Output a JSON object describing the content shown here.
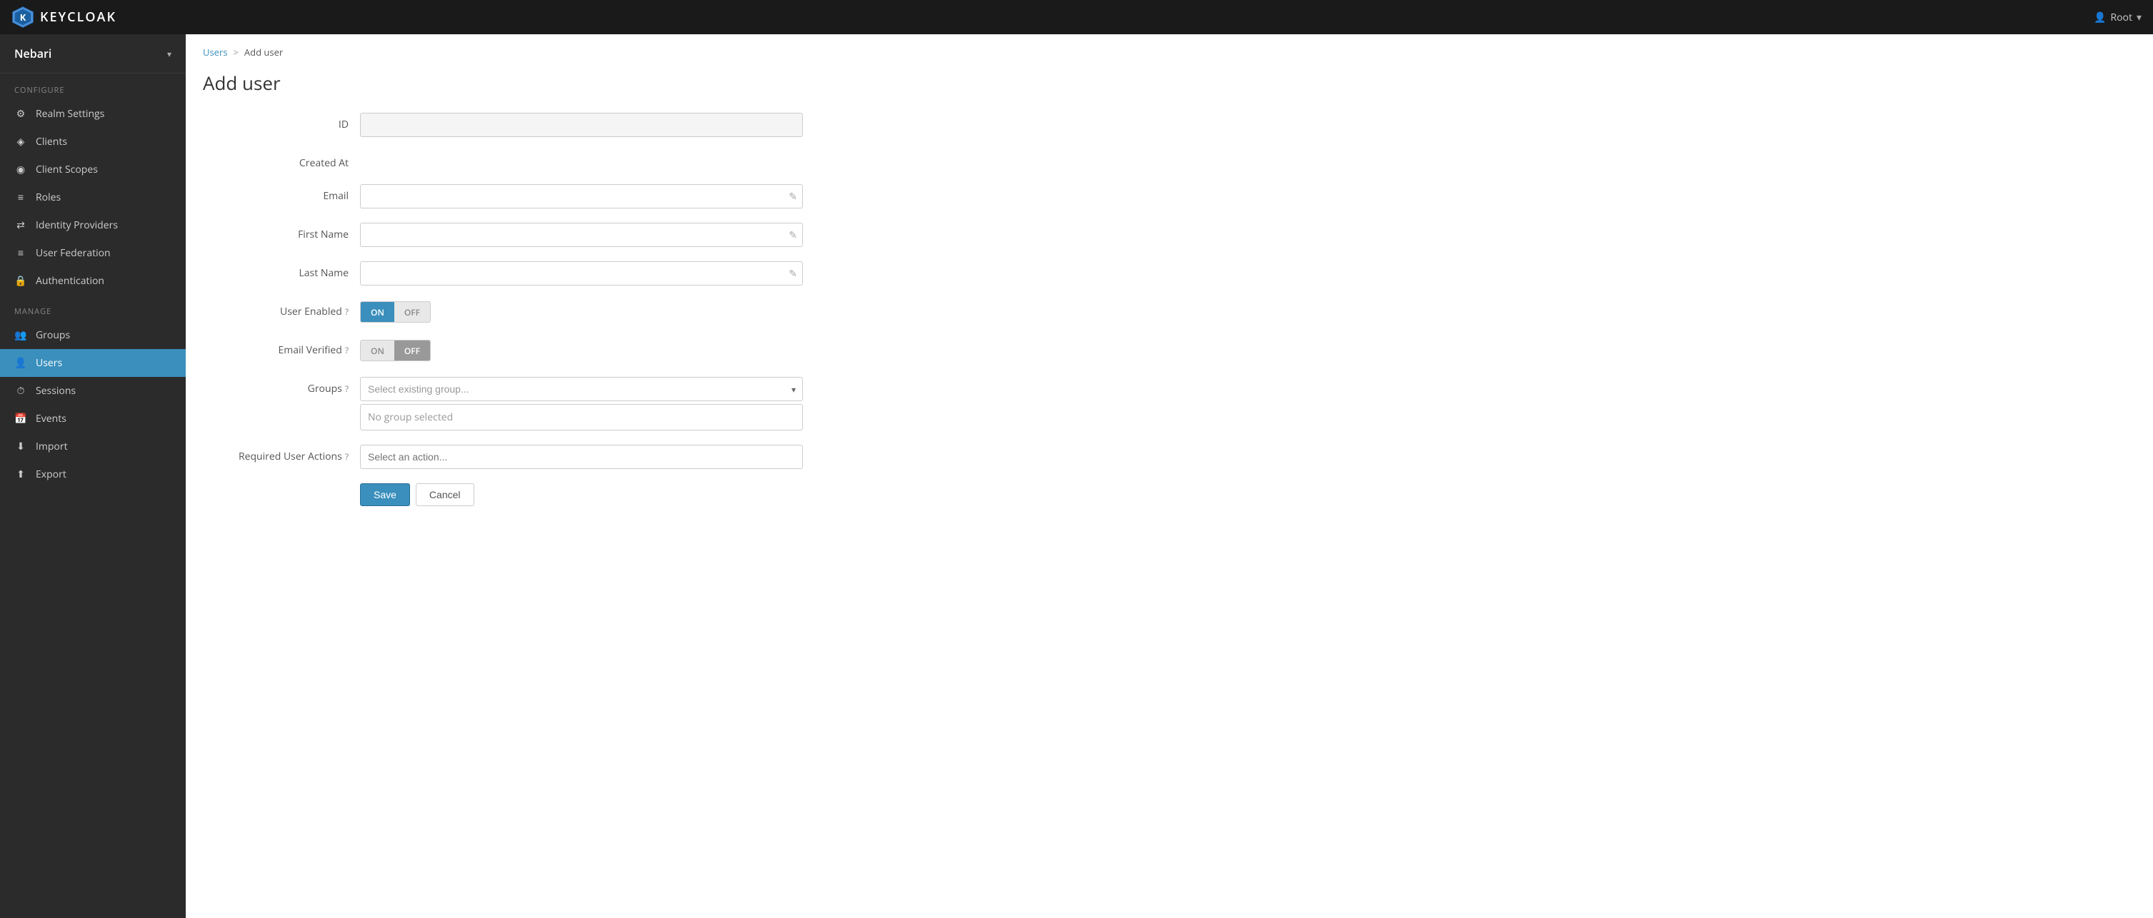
{
  "navbar": {
    "brand": "KEYCLOAK",
    "user_label": "Root",
    "caret": "▾"
  },
  "sidebar": {
    "realm_name": "Nebari",
    "realm_caret": "▾",
    "configure_label": "Configure",
    "manage_label": "Manage",
    "configure_items": [
      {
        "id": "realm-settings",
        "label": "Realm Settings",
        "icon": "⚙"
      },
      {
        "id": "clients",
        "label": "Clients",
        "icon": "◈"
      },
      {
        "id": "client-scopes",
        "label": "Client Scopes",
        "icon": "◉"
      },
      {
        "id": "roles",
        "label": "Roles",
        "icon": "≡"
      },
      {
        "id": "identity-providers",
        "label": "Identity Providers",
        "icon": "⇄"
      },
      {
        "id": "user-federation",
        "label": "User Federation",
        "icon": "≡"
      },
      {
        "id": "authentication",
        "label": "Authentication",
        "icon": "🔒"
      }
    ],
    "manage_items": [
      {
        "id": "groups",
        "label": "Groups",
        "icon": "👥"
      },
      {
        "id": "users",
        "label": "Users",
        "icon": "👤",
        "active": true
      },
      {
        "id": "sessions",
        "label": "Sessions",
        "icon": "⏱"
      },
      {
        "id": "events",
        "label": "Events",
        "icon": "📅"
      },
      {
        "id": "import",
        "label": "Import",
        "icon": "⬇"
      },
      {
        "id": "export",
        "label": "Export",
        "icon": "⬆"
      }
    ]
  },
  "breadcrumb": {
    "parent_label": "Users",
    "separator": ">",
    "current_label": "Add user"
  },
  "page_title": "Add user",
  "form": {
    "id_label": "ID",
    "id_placeholder": "",
    "created_at_label": "Created At",
    "email_label": "Email",
    "email_placeholder": "",
    "first_name_label": "First Name",
    "first_name_placeholder": "",
    "last_name_label": "Last Name",
    "last_name_placeholder": "",
    "user_enabled_label": "User Enabled",
    "user_enabled_on": "ON",
    "user_enabled_off": "OFF",
    "email_verified_label": "Email Verified",
    "email_verified_on": "ON",
    "email_verified_off": "OFF",
    "groups_label": "Groups",
    "groups_placeholder": "Select existing group...",
    "groups_no_selection": "No group selected",
    "required_actions_label": "Required User Actions",
    "required_actions_placeholder": "Select an action...",
    "save_label": "Save",
    "cancel_label": "Cancel"
  }
}
